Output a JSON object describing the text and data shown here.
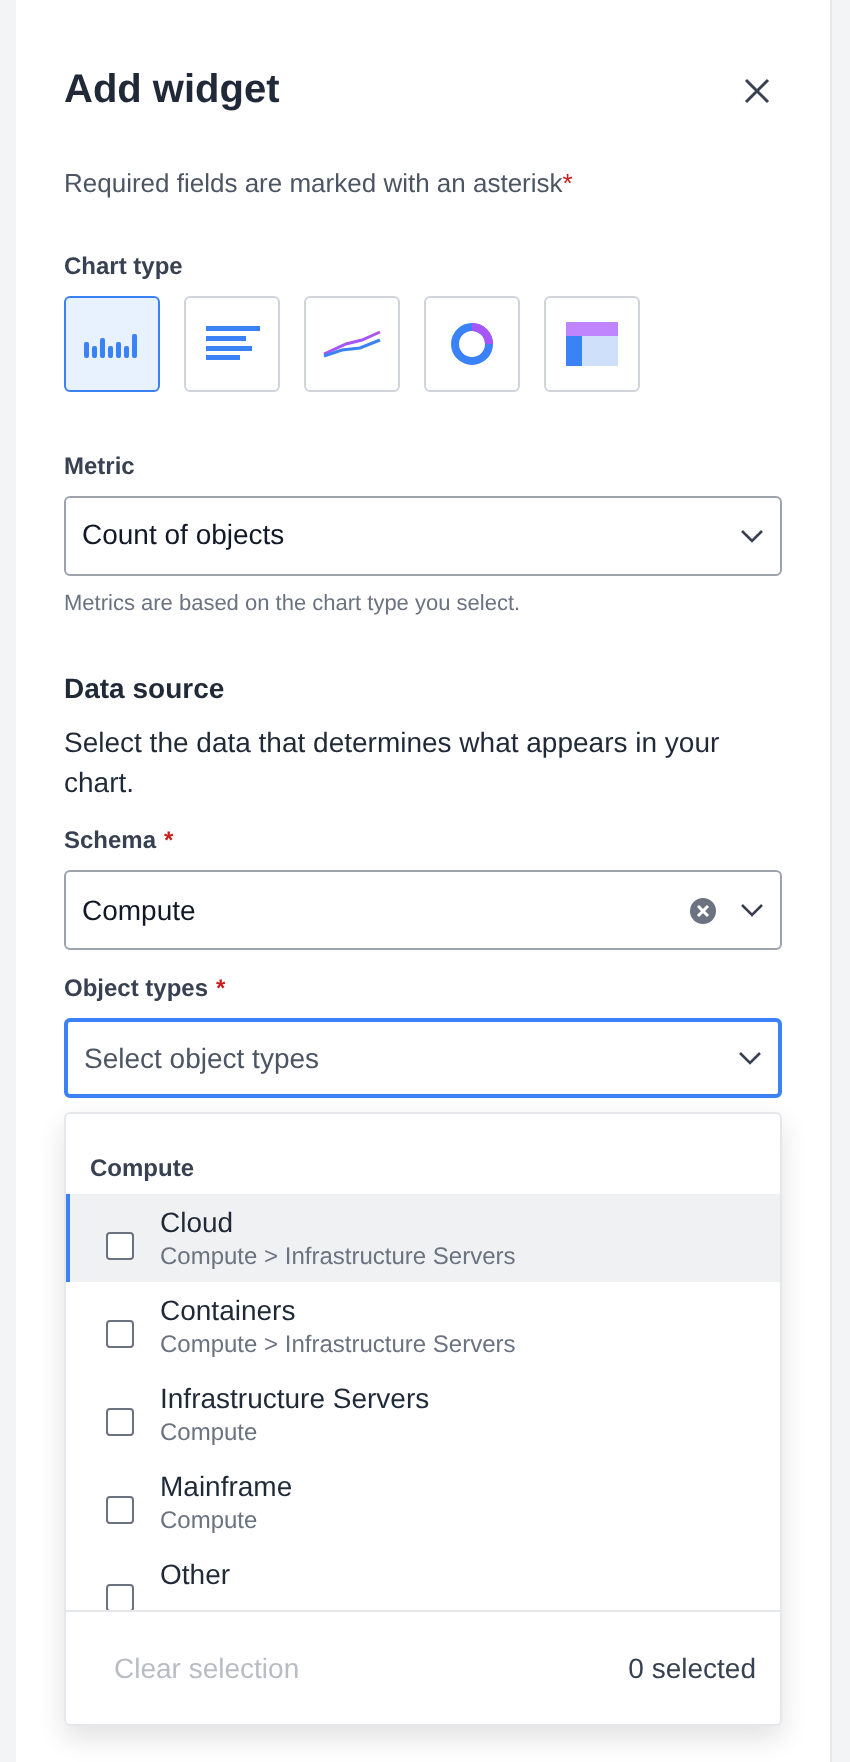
{
  "title": "Add widget",
  "required_note": "Required fields are marked with an asterisk",
  "required_mark": "*",
  "chart_type": {
    "label": "Chart type",
    "options": [
      {
        "kind": "column",
        "selected": true
      },
      {
        "kind": "bar",
        "selected": false
      },
      {
        "kind": "line",
        "selected": false
      },
      {
        "kind": "donut",
        "selected": false
      },
      {
        "kind": "table",
        "selected": false
      }
    ]
  },
  "metric": {
    "label": "Metric",
    "value": "Count of objects",
    "help": "Metrics are based on the chart type you select."
  },
  "data_source": {
    "heading": "Data source",
    "description": "Select the data that determines what appears in your chart."
  },
  "schema": {
    "label": "Schema",
    "required_mark": "*",
    "value": "Compute"
  },
  "object_types": {
    "label": "Object types",
    "required_mark": "*",
    "placeholder": "Select object types",
    "focused": true
  },
  "dropdown": {
    "group": "Compute",
    "items": [
      {
        "name": "Cloud",
        "path": "Compute > Infrastructure Servers",
        "highlighted": true,
        "checked": false
      },
      {
        "name": "Containers",
        "path": "Compute > Infrastructure Servers",
        "highlighted": false,
        "checked": false
      },
      {
        "name": "Infrastructure Servers",
        "path": "Compute",
        "highlighted": false,
        "checked": false
      },
      {
        "name": "Mainframe",
        "path": "Compute",
        "highlighted": false,
        "checked": false
      },
      {
        "name": "Other",
        "highlighted": false,
        "checked": false
      }
    ],
    "clear": "Clear selection",
    "count": "0 selected"
  }
}
